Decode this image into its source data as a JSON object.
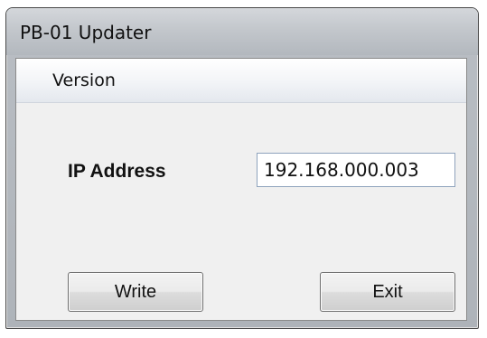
{
  "window": {
    "title": "PB-01 Updater"
  },
  "menu": {
    "items": [
      {
        "label": "Version"
      }
    ]
  },
  "form": {
    "ip_label": "IP Address",
    "ip_value": "192.168.000.003"
  },
  "buttons": {
    "write_label": "Write",
    "exit_label": "Exit"
  }
}
